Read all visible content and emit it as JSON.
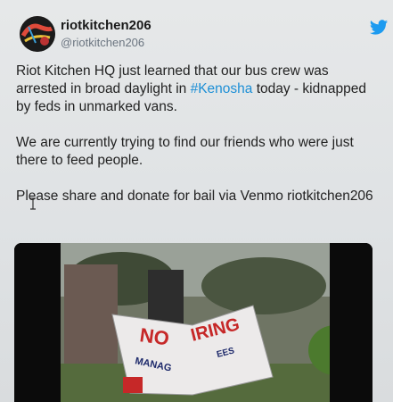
{
  "tweet": {
    "display_name": "riotkitchen206",
    "handle": "@riotkitchen206",
    "paragraph1_before": "Riot Kitchen HQ just learned that our bus crew was arrested in broad daylight in ",
    "hashtag": "#Kenosha",
    "paragraph1_after": " today - kidnapped by feds in unmarked vans.",
    "paragraph2": "We are currently trying to find our friends who were just there to feed people.",
    "paragraph3": "Please share and donate for bail via Venmo riotkitchen206"
  },
  "media": {
    "sign_line1": "NO",
    "sign_line2": "IRING",
    "sign_line3": "MANAG",
    "sign_line4": "EES"
  },
  "colors": {
    "twitter_blue": "#1d9bf0",
    "hashtag": "#1d8fd6",
    "text": "#222222"
  },
  "icons": {
    "brand": "twitter-bird-icon",
    "cursor": "text-cursor-icon"
  }
}
